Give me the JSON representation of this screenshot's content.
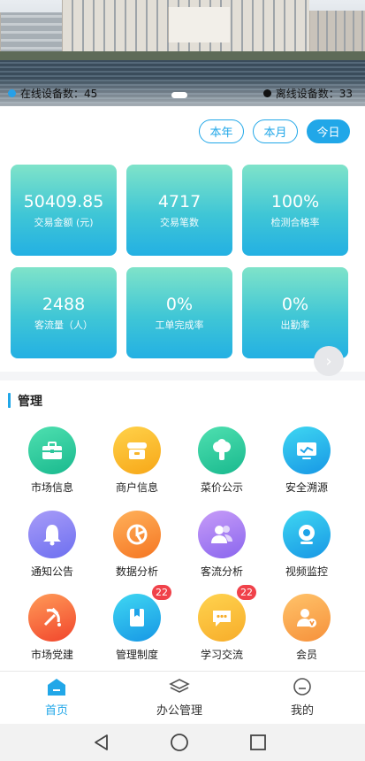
{
  "banner": {
    "online_label": "在线设备数：45",
    "offline_label": "离线设备数：33"
  },
  "periods": [
    "本年",
    "本月",
    "今日"
  ],
  "selected_period": "今日",
  "metrics": [
    {
      "value": "50409.85",
      "label": "交易金额 (元)"
    },
    {
      "value": "4717",
      "label": "交易笔数"
    },
    {
      "value": "100%",
      "label": "检测合格率"
    },
    {
      "value": "2488",
      "label": "客流量（人）"
    },
    {
      "value": "0%",
      "label": "工单完成率"
    },
    {
      "value": "0%",
      "label": "出勤率"
    }
  ],
  "management": {
    "title": "管理",
    "items": [
      {
        "label": "市场信息",
        "icon": "toolbox-icon",
        "color": "#19b98e"
      },
      {
        "label": "商户信息",
        "icon": "store-icon",
        "color": "#f7a718"
      },
      {
        "label": "菜价公示",
        "icon": "vegetable-icon",
        "color": "#19b98e"
      },
      {
        "label": "安全溯源",
        "icon": "monitor-icon",
        "color": "#1797e5"
      },
      {
        "label": "通知公告",
        "icon": "bell-icon",
        "color": "#6d6ff0"
      },
      {
        "label": "数据分析",
        "icon": "pie-chart-icon",
        "color": "#f57623"
      },
      {
        "label": "客流分析",
        "icon": "users-icon",
        "color": "#8a66ee"
      },
      {
        "label": "视频监控",
        "icon": "camera-icon",
        "color": "#1797e5"
      },
      {
        "label": "市场党建",
        "icon": "hammer-sickle-icon",
        "color": "#f1452c"
      },
      {
        "label": "管理制度",
        "icon": "book-icon",
        "color": "#1797e5",
        "badge": "22"
      },
      {
        "label": "学习交流",
        "icon": "chat-icon",
        "color": "#f7ad2a",
        "badge": "22"
      },
      {
        "label": "会员",
        "icon": "member-icon",
        "color": "#f6913b"
      }
    ]
  },
  "tabs": [
    {
      "label": "首页",
      "icon": "home-icon",
      "active": true
    },
    {
      "label": "办公管理",
      "icon": "layers-icon",
      "active": false
    },
    {
      "label": "我的",
      "icon": "profile-icon",
      "active": false
    }
  ],
  "accent_color": "#21a7e8"
}
